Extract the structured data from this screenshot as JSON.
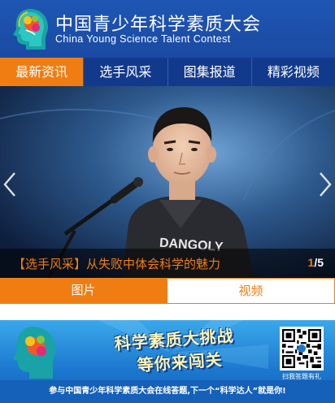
{
  "header": {
    "title_cn": "中国青少年科学素质大会",
    "title_en": "China Young Science Talent Contest"
  },
  "nav": {
    "items": [
      {
        "label": "最新资讯"
      },
      {
        "label": "选手风采"
      },
      {
        "label": "图集报道"
      },
      {
        "label": "精彩视频"
      }
    ],
    "active_index": 0
  },
  "slider": {
    "caption": "【选手风采】从失败中体会科学的魅力",
    "current": "1",
    "total": "/5",
    "shirt_text": "DANGOLY"
  },
  "media_tabs": {
    "items": [
      {
        "label": "图片"
      },
      {
        "label": "视频"
      }
    ],
    "active_index": 0
  },
  "banner": {
    "title": "科学素质大挑战",
    "subtitle": "等你来闯关",
    "qr_label": "扫我答题有礼",
    "footer": "参与中国青少年科学素质大会在线答题,下一个“科学达人”就是你!"
  },
  "colors": {
    "brand_blue": "#1f56b4",
    "nav_blue": "#123a8c",
    "accent_orange": "#f07d12"
  }
}
